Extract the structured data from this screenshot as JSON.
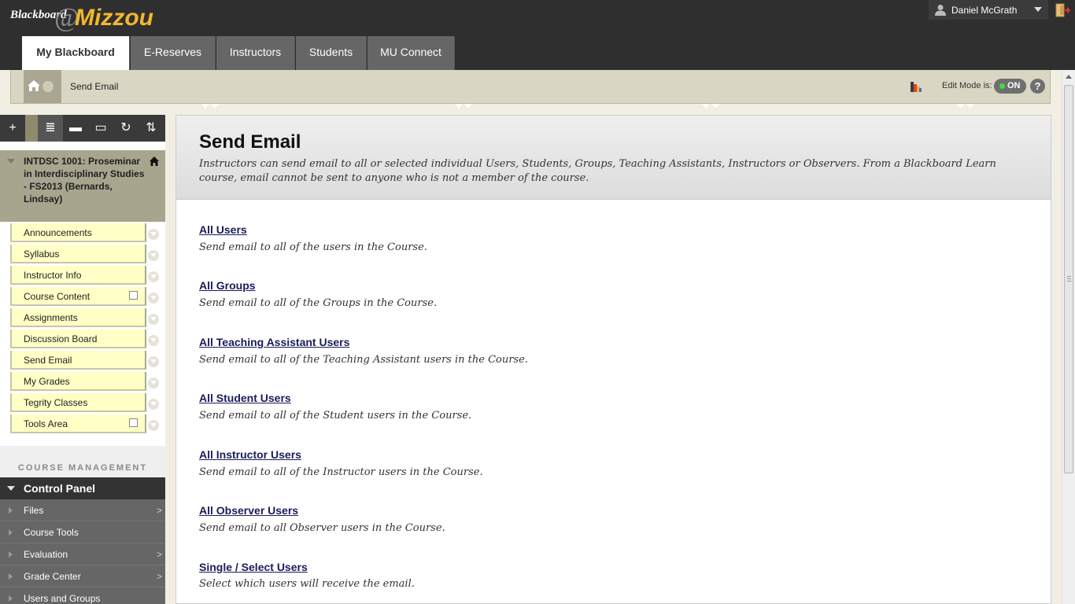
{
  "header": {
    "logo_prefix": "Blackboard",
    "logo_at": "@",
    "logo_brand": "Mizzou",
    "user_name": "Daniel McGrath"
  },
  "tabs": [
    {
      "label": "My Blackboard",
      "active": true
    },
    {
      "label": "E-Reserves",
      "active": false
    },
    {
      "label": "Instructors",
      "active": false
    },
    {
      "label": "Students",
      "active": false
    },
    {
      "label": "MU Connect",
      "active": false
    }
  ],
  "breadcrumb": {
    "current": "Send Email",
    "edit_mode_label": "Edit Mode is:",
    "edit_mode_value": "ON",
    "help": "?"
  },
  "course": {
    "title": "INTDSC 1001: Proseminar in Interdisciplinary Studies - FS2013 (Bernards, Lindsay)"
  },
  "course_menu": [
    {
      "label": "Announcements"
    },
    {
      "label": "Syllabus"
    },
    {
      "label": "Instructor Info"
    },
    {
      "label": "Course Content",
      "icon": "content-area-icon"
    },
    {
      "label": "Assignments"
    },
    {
      "label": "Discussion Board"
    },
    {
      "label": "Send Email"
    },
    {
      "label": "My Grades"
    },
    {
      "label": "Tegrity Classes"
    },
    {
      "label": "Tools Area",
      "icon": "edit-square-icon"
    }
  ],
  "course_management": {
    "label": "COURSE MANAGEMENT",
    "control_panel": "Control Panel",
    "items": [
      {
        "label": "Files",
        "arrow": ">"
      },
      {
        "label": "Course Tools",
        "arrow": ""
      },
      {
        "label": "Evaluation",
        "arrow": ">"
      },
      {
        "label": "Grade Center",
        "arrow": ">"
      },
      {
        "label": "Users and Groups",
        "arrow": ""
      }
    ]
  },
  "main": {
    "title": "Send Email",
    "description": "Instructors can send email to all or selected individual Users, Students, Groups, Teaching Assistants, Instructors or Observers. From a Blackboard Learn course, email cannot be sent to anyone who is not a member of the course.",
    "options": [
      {
        "link": "All Users",
        "desc": "Send email to all of the users in the Course."
      },
      {
        "link": "All Groups",
        "desc": "Send email to all of the Groups in the Course."
      },
      {
        "link": "All Teaching Assistant Users",
        "desc": "Send email to all of the Teaching Assistant users in the Course."
      },
      {
        "link": "All Student Users",
        "desc": "Send email to all of the Student users in the Course."
      },
      {
        "link": "All Instructor Users",
        "desc": "Send email to all of the Instructor users in the Course."
      },
      {
        "link": "All Observer Users",
        "desc": "Send email to all Observer users in the Course."
      },
      {
        "link": "Single / Select Users",
        "desc": "Select which users will receive the email."
      }
    ]
  },
  "colors": {
    "brand_gold": "#f1b82d",
    "header_bg": "#2f2f2f",
    "menu_item_bg": "#ffffc6",
    "link": "#1b1b5c",
    "edit_on": "#3fe03f"
  }
}
